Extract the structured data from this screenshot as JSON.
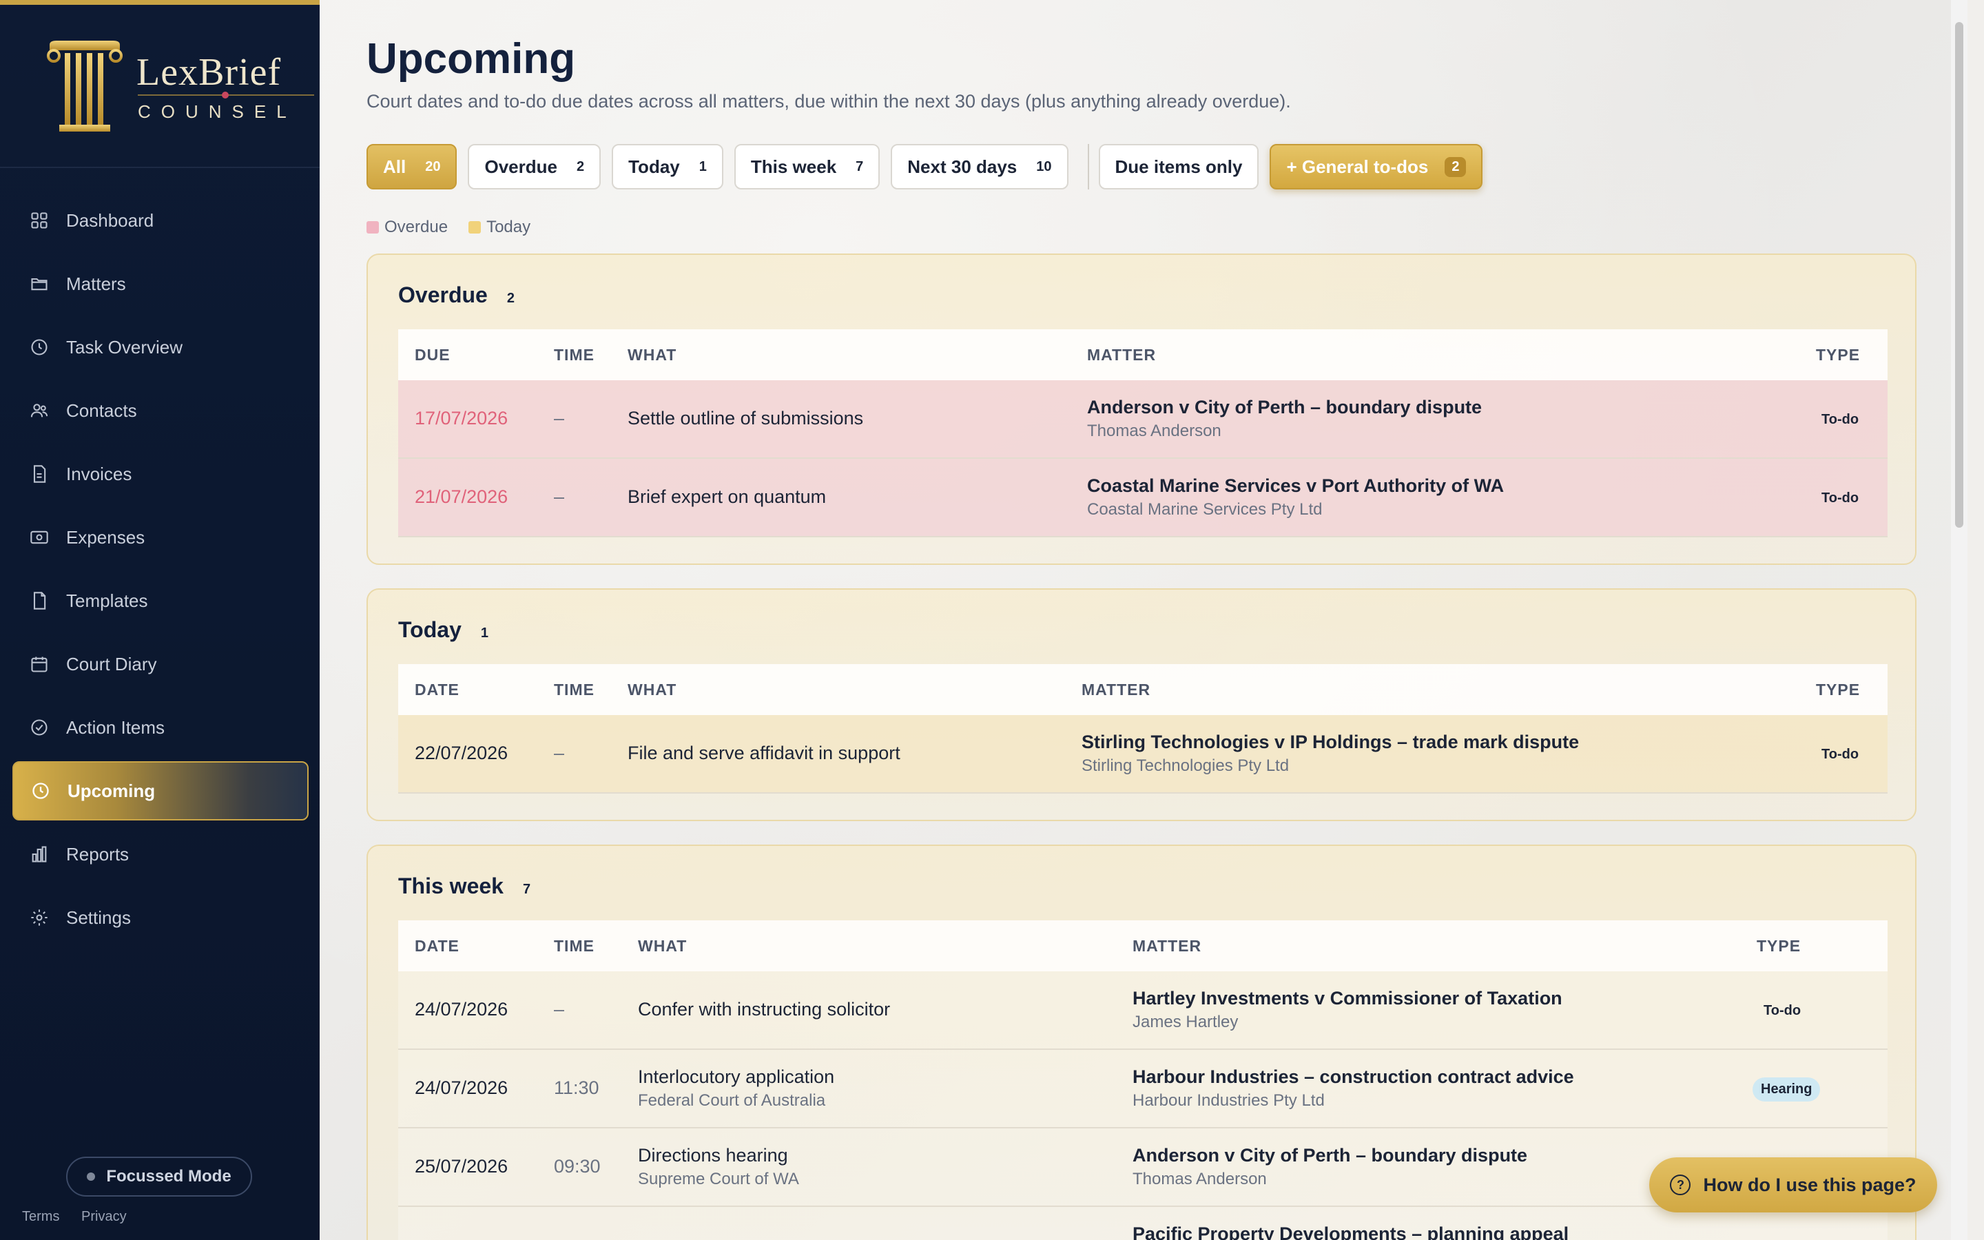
{
  "brand": {
    "name": "LexBrief",
    "sub": "COUNSEL"
  },
  "nav": [
    {
      "label": "Dashboard",
      "icon": "grid-icon"
    },
    {
      "label": "Matters",
      "icon": "folder-icon"
    },
    {
      "label": "Task Overview",
      "icon": "clock-icon"
    },
    {
      "label": "Contacts",
      "icon": "users-icon"
    },
    {
      "label": "Invoices",
      "icon": "invoice-icon"
    },
    {
      "label": "Expenses",
      "icon": "cash-icon"
    },
    {
      "label": "Templates",
      "icon": "file-icon"
    },
    {
      "label": "Court Diary",
      "icon": "calendar-icon"
    },
    {
      "label": "Action Items",
      "icon": "check-circle-icon"
    },
    {
      "label": "Upcoming",
      "icon": "clock-icon",
      "active": true
    },
    {
      "label": "Reports",
      "icon": "bar-chart-icon"
    },
    {
      "label": "Settings",
      "icon": "gear-icon"
    }
  ],
  "focus_mode": "Focussed Mode",
  "footer": {
    "terms": "Terms",
    "privacy": "Privacy"
  },
  "page": {
    "title": "Upcoming",
    "subtitle": "Court dates and to-do due dates across all matters, due within the next 30 days (plus anything already overdue)."
  },
  "filters": {
    "all": {
      "label": "All",
      "count": "20"
    },
    "overdue": {
      "label": "Overdue",
      "count": "2"
    },
    "today": {
      "label": "Today",
      "count": "1"
    },
    "week": {
      "label": "This week",
      "count": "7"
    },
    "next30": {
      "label": "Next 30 days",
      "count": "10"
    },
    "due_only": {
      "label": "Due items only"
    },
    "general": {
      "label": "+ General to-dos",
      "count": "2"
    }
  },
  "legend": {
    "overdue": "Overdue",
    "today": "Today",
    "overdue_color": "#f0b3c0",
    "today_color": "#f1d27a"
  },
  "sections": {
    "overdue": {
      "title": "Overdue",
      "count": "2",
      "headers": {
        "due": "DUE",
        "time": "TIME",
        "what": "WHAT",
        "matter": "MATTER",
        "type": "TYPE"
      },
      "rows": [
        {
          "due": "17/07/2026",
          "time": "–",
          "what": "Settle outline of submissions",
          "matter": "Anderson v City of Perth – boundary dispute",
          "client": "Thomas Anderson",
          "type": "To-do"
        },
        {
          "due": "21/07/2026",
          "time": "–",
          "what": "Brief expert on quantum",
          "matter": "Coastal Marine Services v Port Authority of WA",
          "client": "Coastal Marine Services Pty Ltd",
          "type": "To-do"
        }
      ]
    },
    "today": {
      "title": "Today",
      "count": "1",
      "headers": {
        "due": "DATE",
        "time": "TIME",
        "what": "WHAT",
        "matter": "MATTER",
        "type": "TYPE"
      },
      "rows": [
        {
          "due": "22/07/2026",
          "time": "–",
          "what": "File and serve affidavit in support",
          "matter": "Stirling Technologies v IP Holdings – trade mark dispute",
          "client": "Stirling Technologies Pty Ltd",
          "type": "To-do"
        }
      ]
    },
    "week": {
      "title": "This week",
      "count": "7",
      "headers": {
        "due": "DATE",
        "time": "TIME",
        "what": "WHAT",
        "matter": "MATTER",
        "type": "TYPE"
      },
      "rows": [
        {
          "due": "24/07/2026",
          "time": "–",
          "what": "Confer with instructing solicitor",
          "what_sub": "",
          "matter": "Hartley Investments v Commissioner of Taxation",
          "client": "James Hartley",
          "type": "To-do"
        },
        {
          "due": "24/07/2026",
          "time": "11:30",
          "what": "Interlocutory application",
          "what_sub": "Federal Court of Australia",
          "matter": "Harbour Industries – construction contract advice",
          "client": "Harbour Industries Pty Ltd",
          "type": "Hearing"
        },
        {
          "due": "25/07/2026",
          "time": "09:30",
          "what": "Directions hearing",
          "what_sub": "Supreme Court of WA",
          "matter": "Anderson v City of Perth – boundary dispute",
          "client": "Thomas Anderson",
          "type": ""
        },
        {
          "matter": "Pacific Property Developments – planning appeal"
        }
      ]
    }
  },
  "help": "How do I use this page?"
}
